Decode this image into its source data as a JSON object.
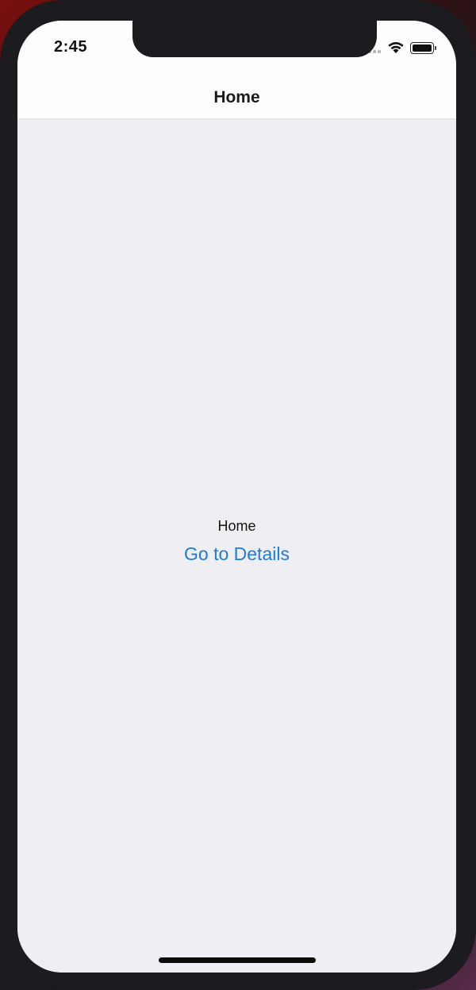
{
  "status_bar": {
    "time": "2:45"
  },
  "nav": {
    "title": "Home"
  },
  "main": {
    "label": "Home",
    "link_label": "Go to Details"
  },
  "colors": {
    "link": "#1c7cde",
    "background": "#efeef2",
    "bar": "#fefefe"
  },
  "icons": {
    "signal": "cellular-signal-icon",
    "wifi": "wifi-icon",
    "battery": "battery-icon"
  }
}
